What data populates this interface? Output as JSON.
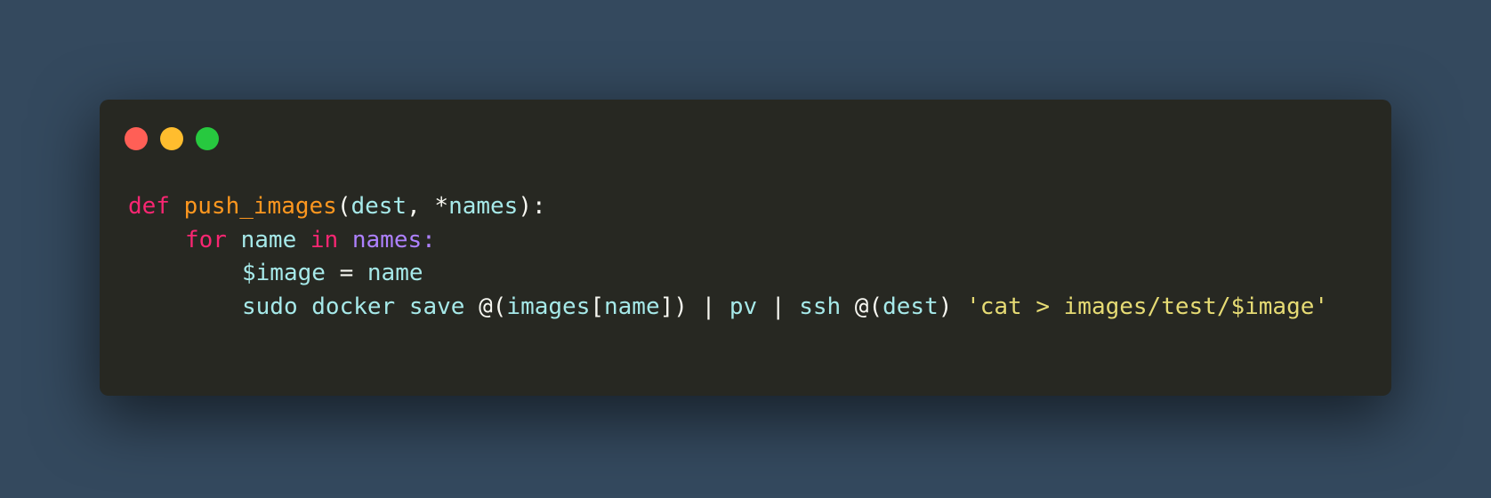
{
  "colors": {
    "background": "#34495e",
    "window": "#272822",
    "close": "#ff5f56",
    "minimize": "#ffbd2e",
    "maximize": "#27c93f",
    "default": "#f8f8f2",
    "keyword": "#f92672",
    "function": "#fd971f",
    "identifier": "#a6e9e9",
    "variable": "#ae81ff",
    "string": "#e6db74"
  },
  "window_controls": [
    "close-dot",
    "minimize-dot",
    "maximize-dot"
  ],
  "code_lines": [
    {
      "indent": 0,
      "tokens": [
        {
          "text": "def",
          "type": "keyword"
        },
        {
          "text": " ",
          "type": "default"
        },
        {
          "text": "push_images",
          "type": "function"
        },
        {
          "text": "(",
          "type": "default"
        },
        {
          "text": "dest",
          "type": "identifier"
        },
        {
          "text": ", *",
          "type": "default"
        },
        {
          "text": "names",
          "type": "identifier"
        },
        {
          "text": "):",
          "type": "default"
        }
      ]
    },
    {
      "indent": 1,
      "tokens": [
        {
          "text": "for",
          "type": "keyword"
        },
        {
          "text": " ",
          "type": "default"
        },
        {
          "text": "name",
          "type": "identifier"
        },
        {
          "text": " ",
          "type": "default"
        },
        {
          "text": "in",
          "type": "keyword"
        },
        {
          "text": " ",
          "type": "default"
        },
        {
          "text": "names:",
          "type": "variable"
        }
      ]
    },
    {
      "indent": 2,
      "tokens": [
        {
          "text": "$image",
          "type": "identifier"
        },
        {
          "text": " = ",
          "type": "default"
        },
        {
          "text": "name",
          "type": "identifier"
        }
      ]
    },
    {
      "indent": 2,
      "tokens": [
        {
          "text": "sudo docker save",
          "type": "identifier"
        },
        {
          "text": " @(",
          "type": "default"
        },
        {
          "text": "images",
          "type": "identifier"
        },
        {
          "text": "[",
          "type": "default"
        },
        {
          "text": "name",
          "type": "identifier"
        },
        {
          "text": "]) | ",
          "type": "default"
        },
        {
          "text": "pv",
          "type": "identifier"
        },
        {
          "text": " | ",
          "type": "default"
        },
        {
          "text": "ssh",
          "type": "identifier"
        },
        {
          "text": " @(",
          "type": "default"
        },
        {
          "text": "dest",
          "type": "identifier"
        },
        {
          "text": ") ",
          "type": "default"
        },
        {
          "text": "'cat > images/test/$image'",
          "type": "string"
        }
      ]
    }
  ]
}
